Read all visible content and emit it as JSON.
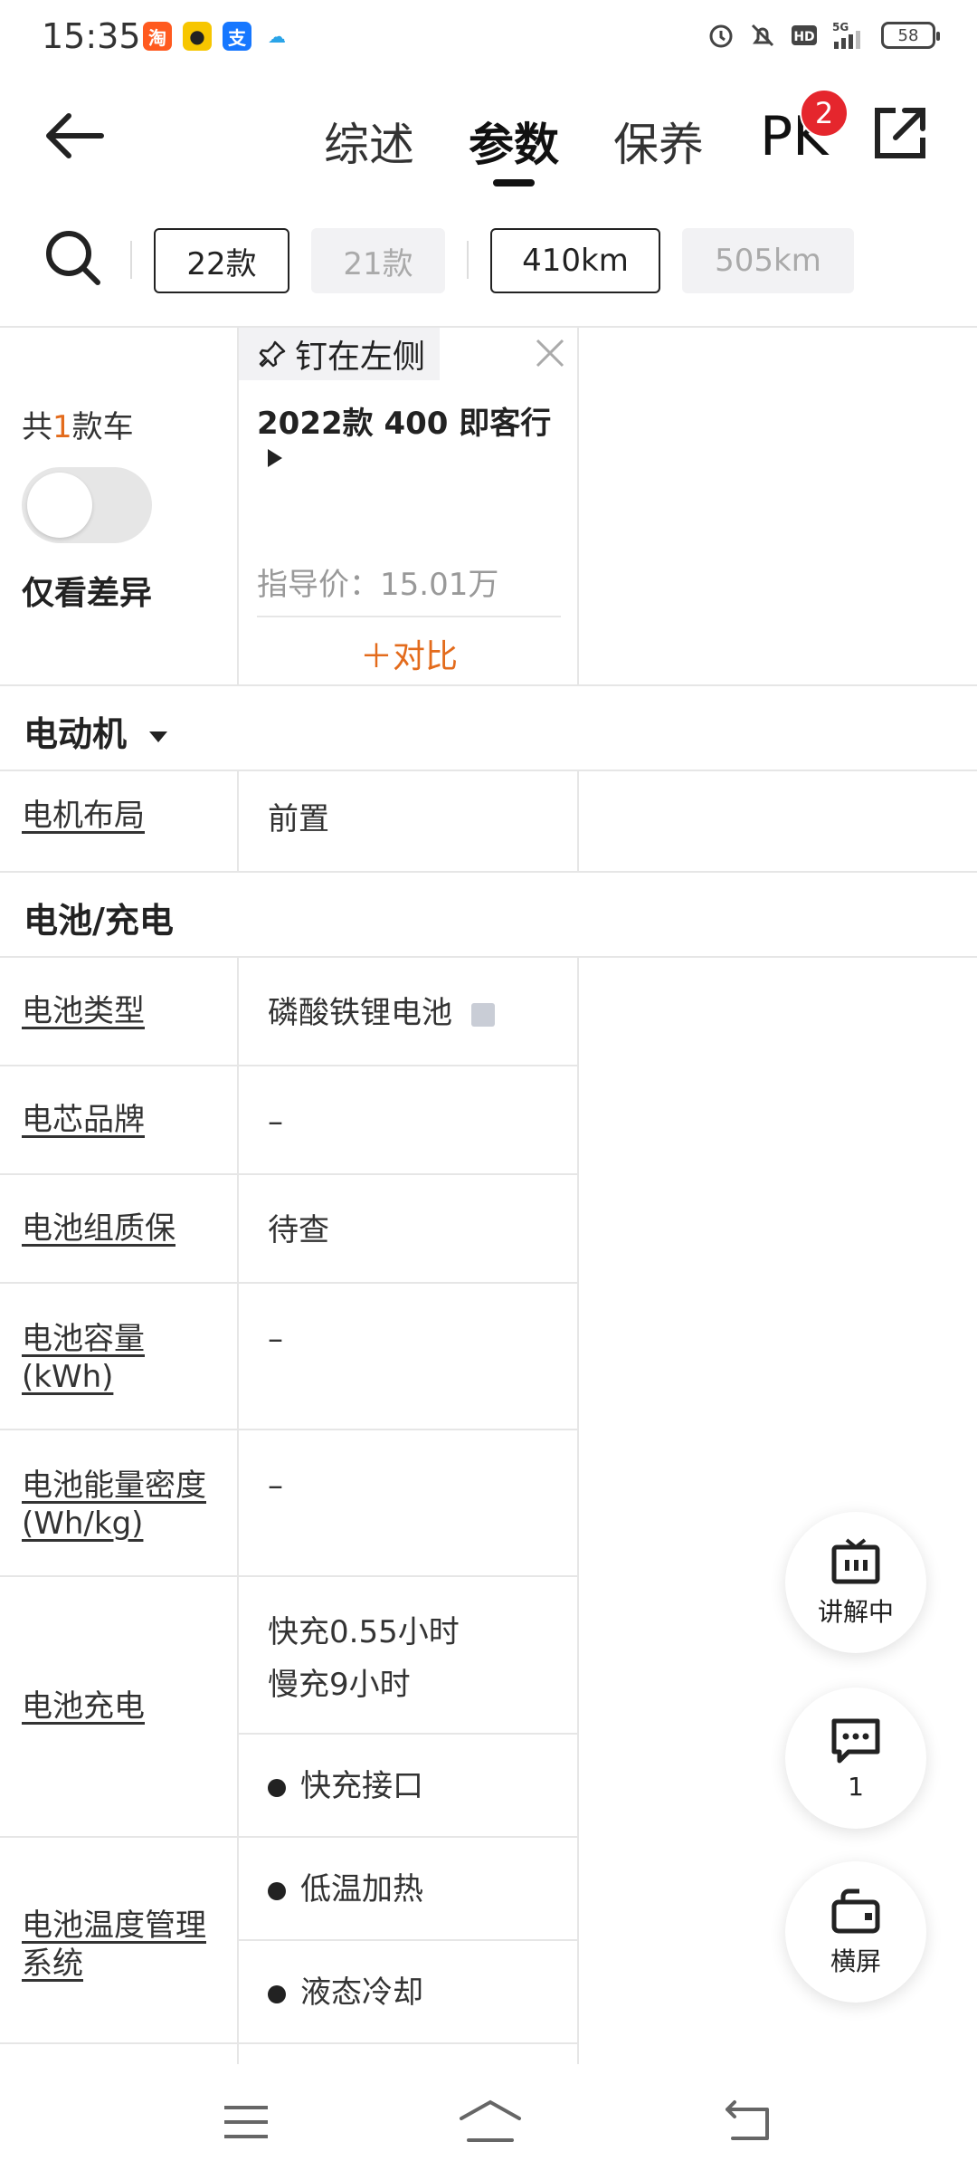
{
  "status_bar": {
    "time": "15:35",
    "apps": [
      {
        "icon": "taobao-app-icon",
        "glyph": "淘",
        "color": "#ff5a1f"
      },
      {
        "icon": "meituan-app-icon",
        "glyph": "●",
        "color": "#f7c600"
      },
      {
        "icon": "alipay-app-icon",
        "glyph": "支",
        "color": "#1677ff"
      },
      {
        "icon": "cloud-app-icon",
        "glyph": "☁",
        "color": "#2aa4e8"
      }
    ],
    "network": "5G",
    "battery": "58"
  },
  "nav": {
    "tabs": [
      {
        "label": "综述",
        "active": false
      },
      {
        "label": "参数",
        "active": true
      },
      {
        "label": "保养",
        "active": false
      }
    ],
    "pk_label": "PK",
    "pk_badge": "2"
  },
  "filters": {
    "years": [
      {
        "label": "22款",
        "selected": true
      },
      {
        "label": "21款",
        "selected": false
      }
    ],
    "ranges": [
      {
        "label": "410km",
        "selected": true
      },
      {
        "label": "505km",
        "selected": false
      }
    ]
  },
  "car_panel": {
    "count_prefix": "共",
    "count_num": "1",
    "count_suffix": "款车",
    "only_diff_label": "仅看差异",
    "pin_label": "钉在左侧",
    "car_name": "2022款 400 即客行",
    "price": "指导价：15.01万",
    "compare_label": "＋对比"
  },
  "sections": {
    "motor": {
      "title": "电动机",
      "rows": [
        {
          "label": "电机布局",
          "value": "前置"
        }
      ]
    },
    "battery": {
      "title": "电池/充电",
      "rows": [
        {
          "label": "电池类型",
          "value": "磷酸铁锂电池"
        },
        {
          "label": "电芯品牌",
          "value": "–"
        },
        {
          "label": "电池组质保",
          "value": "待查"
        },
        {
          "label": "电池容量(kWh)",
          "value": "–"
        },
        {
          "label": "电池能量密度(Wh/kg)",
          "value": "–"
        },
        {
          "label": "电池充电",
          "value_line1": "快充0.55小时",
          "value_line2": "慢充9小时",
          "bullet": "快充接口"
        },
        {
          "label": "电池温度管理系统",
          "bullet1": "低温加热",
          "bullet2": "液态冷却"
        }
      ]
    }
  },
  "floating": {
    "live_label": "讲解中",
    "comment_count": "1",
    "landscape_label": "横屏"
  }
}
